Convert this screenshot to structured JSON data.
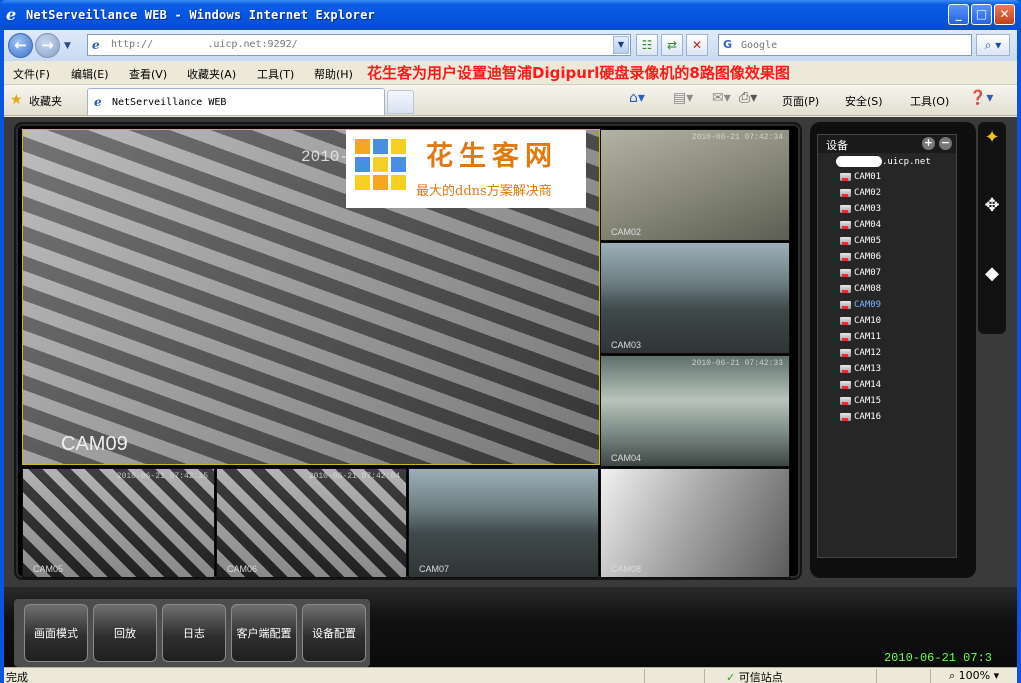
{
  "window": {
    "title": "NetServeillance WEB - Windows Internet Explorer",
    "min_glyph": "_",
    "max_glyph": "□",
    "close_glyph": "✕"
  },
  "address": {
    "url_prefix": "http://",
    "url_suffix": ".uicp.net:9292/",
    "search_placeholder": "Google",
    "google_glyph": "G"
  },
  "menu": {
    "items": [
      "文件(F)",
      "编辑(E)",
      "查看(V)",
      "收藏夹(A)",
      "工具(T)",
      "帮助(H)"
    ],
    "banner": "花生客为用户设置迪智浦Digipurl硬盘录像机的8路图像效果图"
  },
  "favbar": {
    "favorites_label": "收藏夹",
    "tab_title": "NetServeillance WEB",
    "commands": {
      "page": "页面(P)",
      "safety": "安全(S)",
      "tools": "工具(O)"
    }
  },
  "logo": {
    "title": "花生客网",
    "subtitle": "最大的ddns方案解决商"
  },
  "cameras": {
    "main": {
      "label": "CAM09",
      "timestamp": "2010-"
    },
    "thumbs": [
      {
        "label": "CAM02",
        "timestamp": "2010-06-21 07:42:34"
      },
      {
        "label": "CAM03",
        "timestamp": ""
      },
      {
        "label": "CAM04",
        "timestamp": "2010-06-21 07:42:33"
      },
      {
        "label": "CAM05",
        "timestamp": "2010-06-21 07:42:35"
      },
      {
        "label": "CAM06",
        "timestamp": "2010-06-21 07:42:04"
      },
      {
        "label": "CAM07",
        "timestamp": ""
      },
      {
        "label": "CAM08",
        "timestamp": ""
      }
    ]
  },
  "tree": {
    "header": "设备",
    "plus": "+",
    "minus": "−",
    "root_suffix": ".uicp.net",
    "items": [
      "CAM01",
      "CAM02",
      "CAM03",
      "CAM04",
      "CAM05",
      "CAM06",
      "CAM07",
      "CAM08",
      "CAM09",
      "CAM10",
      "CAM11",
      "CAM12",
      "CAM13",
      "CAM14",
      "CAM15",
      "CAM16"
    ],
    "selected": "CAM09"
  },
  "buttons": {
    "screen_mode": "画面模式",
    "playback": "回放",
    "log": "日志",
    "client_config": "客户端配置",
    "device_config": "设备配置"
  },
  "clock": "2010-06-21  07:3",
  "status": {
    "done": "完成",
    "trusted": "可信站点",
    "zoom": "100%"
  },
  "colors": {
    "banner": "#ff1a1a",
    "clock": "#6cff4a",
    "logo": "#e07a10",
    "selected_tree": "#7db3ff"
  }
}
